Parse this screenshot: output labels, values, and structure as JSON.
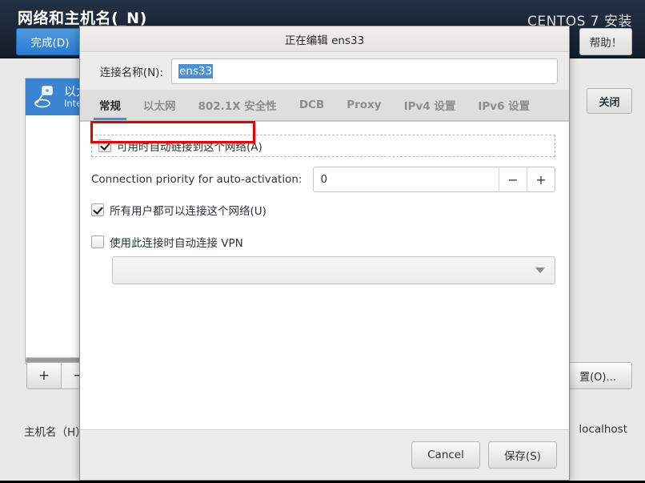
{
  "installer": {
    "title": "网络和主机名(_N)",
    "brand": "CENTOS 7 安装",
    "done_label": "完成(D)",
    "help_label": "帮助！",
    "close_label": "关闭",
    "configure_label": "置(O)...",
    "add_label": "+",
    "remove_label": "−",
    "hostname_label": "主机名（H）",
    "hostname_value": "localhost",
    "connection": {
      "name": "以太",
      "sub": "Intel (",
      "icon": "ethernet-icon",
      "selected": true
    }
  },
  "dialog": {
    "title": "正在编辑 ens33",
    "name_label": "连接名称(N):",
    "name_value": "ens33",
    "tabs": [
      {
        "label": "常规",
        "active": true
      },
      {
        "label": "以太网",
        "active": false
      },
      {
        "label": "802.1X 安全性",
        "active": false
      },
      {
        "label": "DCB",
        "active": false
      },
      {
        "label": "Proxy",
        "active": false
      },
      {
        "label": "IPv4 设置",
        "active": false
      },
      {
        "label": "IPv6 设置",
        "active": false
      }
    ],
    "general": {
      "auto_connect_label": "可用时自动链接到这个网络(A)",
      "auto_connect_checked": true,
      "priority_label": "Connection priority for auto-activation:",
      "priority_value": "0",
      "priority_decrement": "−",
      "priority_increment": "+",
      "all_users_label": "所有用户都可以连接这个网络(U)",
      "all_users_checked": true,
      "vpn_label": "使用此连接时自动连接 VPN",
      "vpn_checked": false,
      "vpn_combo_value": ""
    },
    "footer": {
      "cancel_label": "Cancel",
      "save_label": "保存(S)"
    }
  },
  "colors": {
    "accent": "#4a90d9",
    "header_bg": "#1c2636",
    "annotation": "#ee0000",
    "selection": "#3a84d2"
  }
}
